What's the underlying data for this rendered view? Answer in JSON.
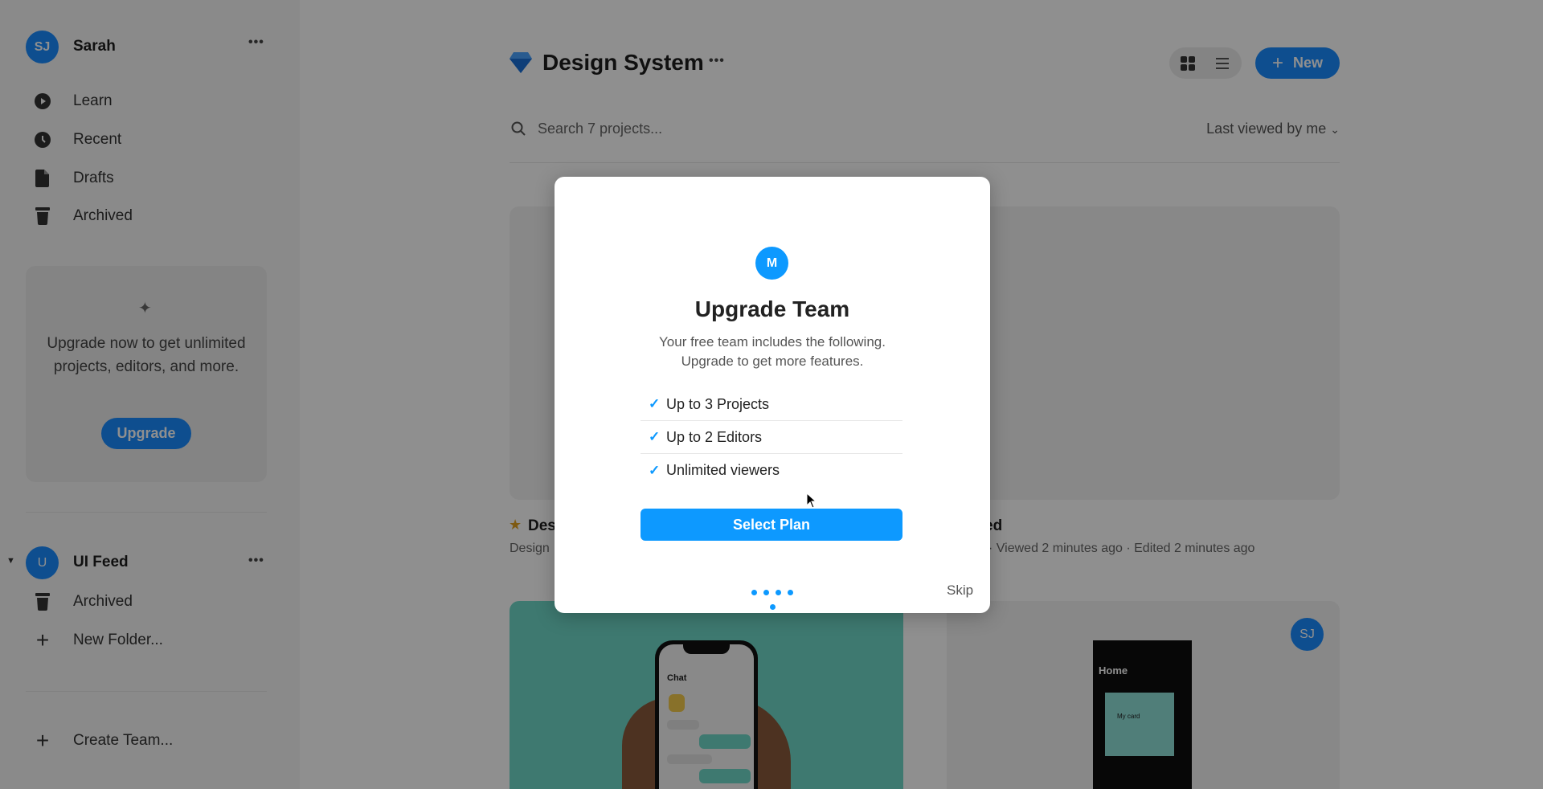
{
  "sidebar": {
    "user": {
      "initials": "SJ",
      "name": "Sarah",
      "menu": "•••"
    },
    "nav": [
      {
        "label": "Learn",
        "icon": "play-circle-icon"
      },
      {
        "label": "Recent",
        "icon": "clock-icon"
      },
      {
        "label": "Drafts",
        "icon": "file-icon"
      },
      {
        "label": "Archived",
        "icon": "trash-icon"
      }
    ],
    "upgrade_box": {
      "text": "Upgrade now to get unlimited projects, editors, and more.",
      "button": "Upgrade",
      "icon": "sparkle-icon"
    },
    "team": {
      "initial": "U",
      "name": "UI Feed",
      "menu": "•••",
      "items": [
        {
          "label": "Archived",
          "icon": "trash-icon"
        },
        {
          "label": "New Folder...",
          "icon": "plus-icon"
        }
      ]
    },
    "create_team": "Create Team..."
  },
  "header": {
    "title": "Design System",
    "icon": "diamond-icon",
    "menu": "•••",
    "new_button": "New",
    "view_modes": [
      "grid",
      "list"
    ]
  },
  "search": {
    "placeholder": "Search 7 projects...",
    "sort": "Last viewed by me"
  },
  "cards": [
    {
      "title": "Des",
      "meta": "Design"
    },
    {
      "title": "ed",
      "meta": "· Viewed 2 minutes ago · Edited 2 minutes ago"
    },
    {
      "thumb_title": "Chat"
    },
    {
      "thumb_title": "Home",
      "thumb_card": "My card",
      "avatar": "SJ"
    }
  ],
  "modal": {
    "avatar": "M",
    "title": "Upgrade Team",
    "subtitle_1": "Your free team includes the following.",
    "subtitle_2": "Upgrade to get more features.",
    "features": [
      "Up to 3 Projects",
      "Up to 2 Editors",
      "Unlimited viewers"
    ],
    "button": "Select Plan",
    "steps": 5,
    "skip": "Skip"
  },
  "colors": {
    "accent": "#0d99ff",
    "brand_blue": "#1a8cff",
    "teal": "#6fd8c8"
  }
}
